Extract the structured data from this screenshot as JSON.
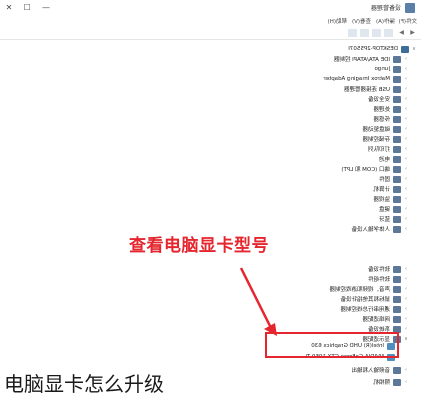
{
  "window": {
    "title": "设备管理器",
    "controls": [
      "—",
      "☐",
      "✕"
    ]
  },
  "menu": [
    "文件(F)",
    "操作(A)",
    "查看(V)",
    "帮助(H)"
  ],
  "tree": {
    "root": "DESKTOP-2P5507I",
    "items": [
      "IDE ATA/ATAPI 控制器",
      "Jungo",
      "Matrox Imaging Adapter",
      "USB 连接器管理器",
      "安全设备",
      "处理器",
      "传感器",
      "磁盘驱动器",
      "存储控制器",
      "打印队列",
      "电池",
      "端口 (COM 和 LPT)",
      "固件",
      "计算机",
      "监视器",
      "键盘",
      "蓝牙",
      "人体学输入设备",
      "软件设备",
      "软件组件",
      "声音、视频和游戏控制器",
      "鼠标和其他指针设备",
      "通用串行总线控制器",
      "网络适配器",
      "系统设备",
      "显示适配器"
    ],
    "gpus": [
      "Intel(R) UHD Graphics 630",
      "NVIDIA GeForce GTX 1050 Ti"
    ],
    "after": [
      "音频输入和输出",
      "照相机"
    ]
  },
  "annotation": {
    "callout": "查看电脑显卡型号"
  },
  "caption": "电脑显卡怎么升级"
}
